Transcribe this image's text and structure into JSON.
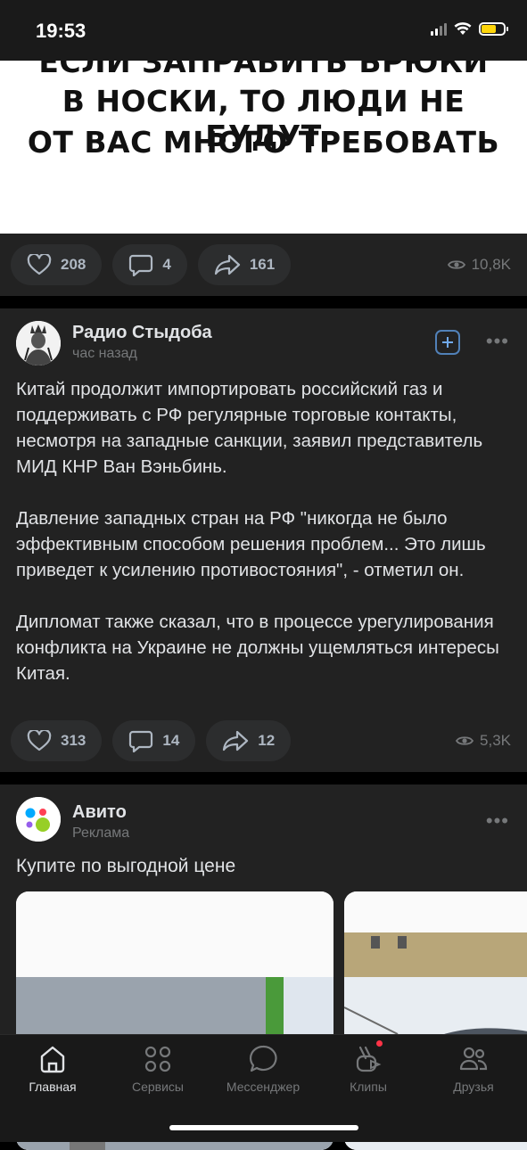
{
  "status_bar": {
    "time": "19:53",
    "battery_color": "#ffd60a"
  },
  "post1": {
    "image_text": [
      "ЕСЛИ ЗАПРАВИТЬ БРЮКИ",
      "В НОСКИ, ТО ЛЮДИ НЕ БУДУТ",
      "ОТ ВАС МНОГО ТРЕБОВАТЬ"
    ],
    "likes": "208",
    "comments": "4",
    "shares": "161",
    "views": "10,8K"
  },
  "post2": {
    "author": "Радио Стыдоба",
    "time": "час назад",
    "text": "Китай продолжит импортировать российский газ и поддерживать с РФ регулярные торговые контакты, несмотря на западные санкции, заявил представитель МИД КНР Ван Вэньбинь.\n\nДавление западных стран на РФ \"никогда не было эффективным способом решения проблем... Это лишь приведет к усилению противостояния\", - отметил он.\n\nДипломат также сказал, что в процессе урегулирования конфликта на Украине не должны ущемляться интересы Китая.",
    "likes": "313",
    "comments": "14",
    "shares": "12",
    "views": "5,3K"
  },
  "post3": {
    "author": "Авито",
    "label": "Реклама",
    "text": "Купите по выгодной цене"
  },
  "tabbar": {
    "items": [
      {
        "label": "Главная",
        "icon": "home-icon",
        "active": true
      },
      {
        "label": "Сервисы",
        "icon": "services-icon"
      },
      {
        "label": "Мессенджер",
        "icon": "messenger-icon"
      },
      {
        "label": "Клипы",
        "icon": "clips-icon",
        "badge": true
      },
      {
        "label": "Друзья",
        "icon": "friends-icon"
      }
    ]
  },
  "colors": {
    "accent": "#71aaeb",
    "badge": "#ff3347",
    "background": "#222222"
  }
}
